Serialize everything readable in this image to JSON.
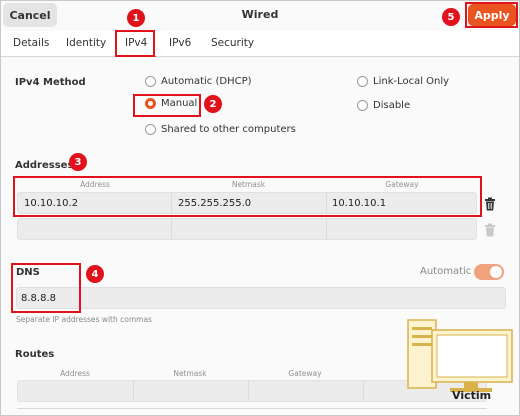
{
  "window": {
    "title": "Wired"
  },
  "header": {
    "cancel_label": "Cancel",
    "apply_label": "Apply"
  },
  "tabs": [
    {
      "label": "Details"
    },
    {
      "label": "Identity"
    },
    {
      "label": "IPv4"
    },
    {
      "label": "IPv6"
    },
    {
      "label": "Security"
    }
  ],
  "ipv4_method": {
    "label": "IPv4 Method",
    "options": [
      {
        "label": "Automatic (DHCP)",
        "selected": false
      },
      {
        "label": "Manual",
        "selected": true
      },
      {
        "label": "Shared to other computers",
        "selected": false
      },
      {
        "label": "Link-Local Only",
        "selected": false
      },
      {
        "label": "Disable",
        "selected": false
      }
    ]
  },
  "addresses": {
    "label": "Addresses",
    "columns": [
      "Address",
      "Netmask",
      "Gateway"
    ],
    "rows": [
      [
        "10.10.10.2",
        "255.255.255.0",
        "10.10.10.1"
      ],
      [
        "",
        "",
        ""
      ]
    ]
  },
  "dns": {
    "label": "DNS",
    "automatic_label": "Automatic",
    "automatic_on": true,
    "value": "8.8.8.8",
    "hint": "Separate IP addresses with commas"
  },
  "routes": {
    "label": "Routes",
    "columns": [
      "Address",
      "Netmask",
      "Gateway"
    ]
  },
  "annotations": [
    "1",
    "2",
    "3",
    "4",
    "5"
  ],
  "overlay": {
    "label": "Victim"
  },
  "colors": {
    "accent": "#e95420",
    "annotation": "#e0121b"
  }
}
